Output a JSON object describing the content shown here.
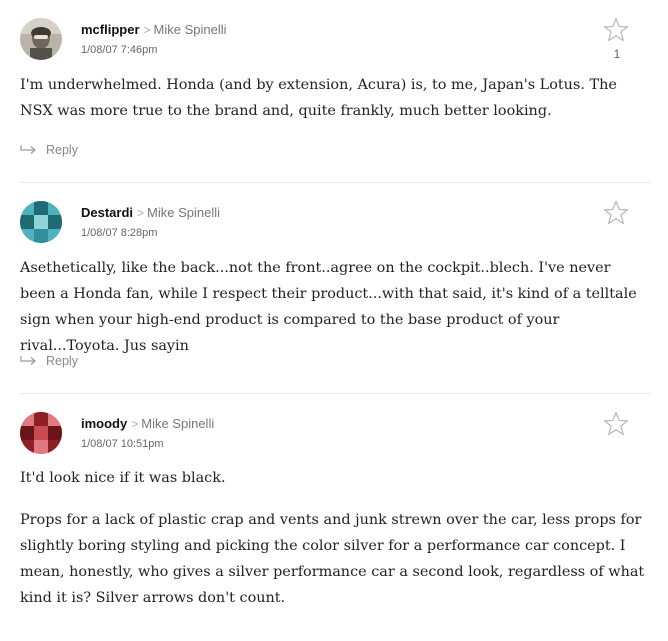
{
  "comments": [
    {
      "author": "mcflipper",
      "reply_to": "Mike Spinelli",
      "timestamp": "1/08/07 7:46pm",
      "star_count": "1",
      "avatar": "photo-avatar",
      "paragraphs": [
        "I'm underwhelmed. Honda (and by extension, Acura) is, to me, Japan's Lotus. The NSX was more true to the brand and, quite frankly, much better looking."
      ],
      "reply_label": "Reply"
    },
    {
      "author": "Destardi",
      "reply_to": "Mike Spinelli",
      "timestamp": "1/08/07 8:28pm",
      "star_count": "",
      "avatar": "teal-pixel-avatar",
      "paragraphs": [
        "Asethetically, like the back...not the front..agree on the cockpit..blech. I've never been a Honda fan, while I respect their product...with that said, it's kind of a telltale sign when your high-end product is compared to the base product of your rival...Toyota. Jus sayin"
      ],
      "reply_label": "Reply"
    },
    {
      "author": "imoody",
      "reply_to": "Mike Spinelli",
      "timestamp": "1/08/07 10:51pm",
      "star_count": "",
      "avatar": "red-pixel-avatar",
      "paragraphs": [
        "It'd look nice if it was black.",
        "Props for a lack of plastic crap and vents and junk strewn over the car, less props for slightly boring styling and picking the color silver for a performance car concept. I mean, honestly, who gives a silver performance car a second look, regardless of what kind it is? Silver arrows don't count."
      ],
      "reply_label": ""
    }
  ],
  "colors": {
    "text": "#222222",
    "meta": "#777777",
    "star": "#bbbbbb",
    "divider": "#e6e6e6",
    "teal_avatar": "#2f8f9a",
    "red_avatar": "#b8333a"
  },
  "icons": {
    "star": "star-icon",
    "reply": "reply-arrow-icon",
    "chevron": "chevron-right-icon"
  }
}
